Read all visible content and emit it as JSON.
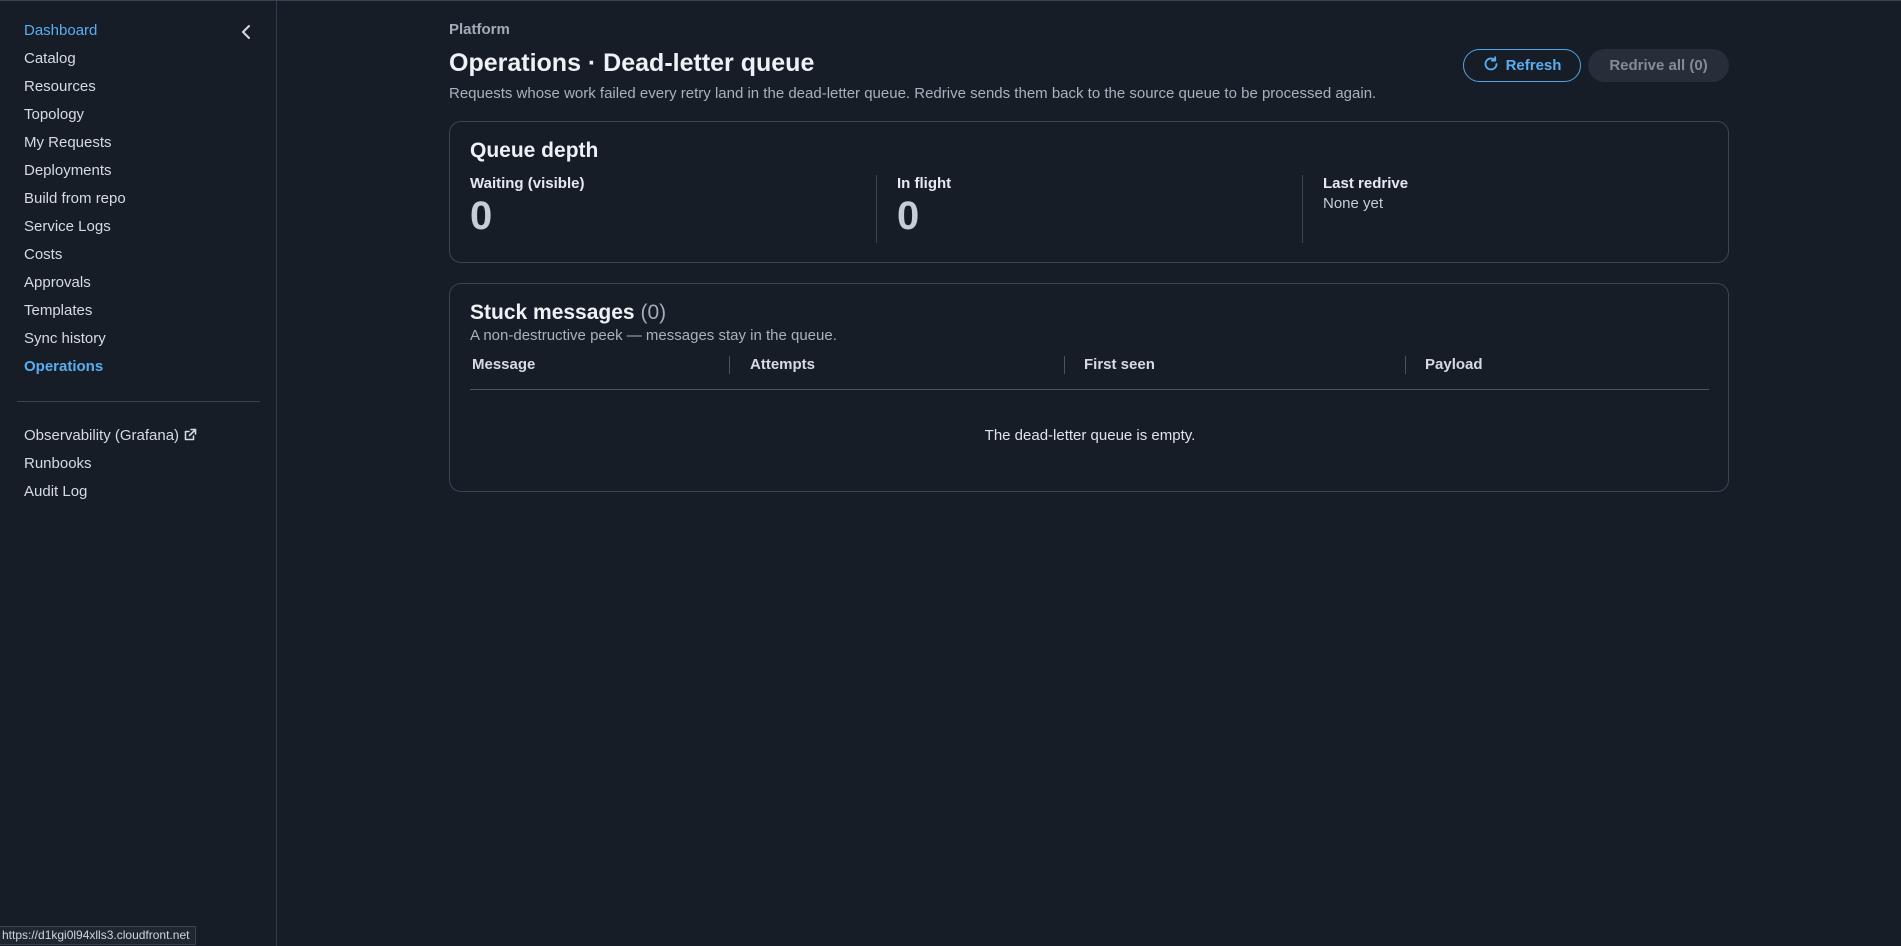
{
  "sidebar": {
    "items": [
      {
        "label": "Dashboard"
      },
      {
        "label": "Catalog"
      },
      {
        "label": "Resources"
      },
      {
        "label": "Topology"
      },
      {
        "label": "My Requests"
      },
      {
        "label": "Deployments"
      },
      {
        "label": "Build from repo"
      },
      {
        "label": "Service Logs"
      },
      {
        "label": "Costs"
      },
      {
        "label": "Approvals"
      },
      {
        "label": "Templates"
      },
      {
        "label": "Sync history"
      },
      {
        "label": "Operations"
      }
    ],
    "external": [
      {
        "label": "Observability (Grafana)"
      },
      {
        "label": "Runbooks"
      },
      {
        "label": "Audit Log"
      }
    ],
    "collapse_icon": "chevron-left-icon",
    "external_link_icon": "external-link-icon",
    "active_item": "Operations"
  },
  "status_bar": {
    "url": "https://d1kgi0l94xlls3.cloudfront.net"
  },
  "header": {
    "eyebrow": "Platform",
    "title": "Operations · Dead-letter queue",
    "description": "Requests whose work failed every retry land in the dead-letter queue. Redrive sends them back to the source queue to be processed again."
  },
  "actions": {
    "refresh_label": "Refresh",
    "refresh_icon": "refresh-icon",
    "redrive_label": "Redrive all (0)"
  },
  "queue_depth": {
    "title": "Queue depth",
    "waiting_label": "Waiting (visible)",
    "waiting_value": "0",
    "in_flight_label": "In flight",
    "in_flight_value": "0",
    "last_redrive_label": "Last redrive",
    "last_redrive_value": "None yet"
  },
  "stuck_messages": {
    "title": "Stuck messages",
    "count": "(0)",
    "subtitle": "A non-destructive peek — messages stay in the queue.",
    "columns": [
      "Message",
      "Attempts",
      "First seen",
      "Payload"
    ],
    "empty_text": "The dead-letter queue is empty."
  },
  "colors": {
    "background": "#161d27",
    "accent": "#5aaef0",
    "border": "#3c4552"
  }
}
